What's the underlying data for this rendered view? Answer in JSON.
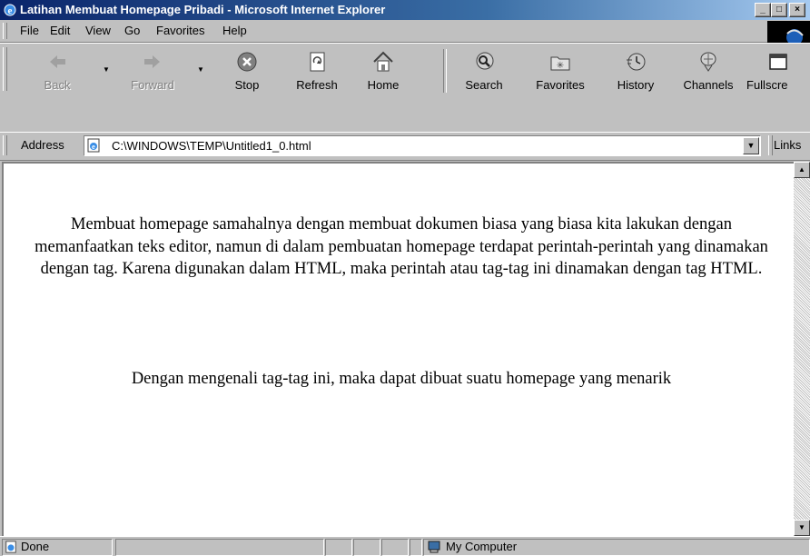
{
  "window": {
    "title": "Latihan Membuat Homepage Pribadi - Microsoft Internet Explorer",
    "controls": {
      "minimize": "_",
      "maximize": "□",
      "close": "×"
    }
  },
  "menu": {
    "items": [
      "File",
      "Edit",
      "View",
      "Go",
      "Favorites",
      "Help"
    ]
  },
  "toolbar": {
    "buttons": [
      {
        "label": "Back",
        "icon": "back-arrow-icon",
        "enabled": false
      },
      {
        "label": "Forward",
        "icon": "forward-arrow-icon",
        "enabled": false
      },
      {
        "label": "Stop",
        "icon": "stop-icon",
        "enabled": true
      },
      {
        "label": "Refresh",
        "icon": "refresh-icon",
        "enabled": true
      },
      {
        "label": "Home",
        "icon": "home-icon",
        "enabled": true
      },
      {
        "label": "Search",
        "icon": "search-icon",
        "enabled": true
      },
      {
        "label": "Favorites",
        "icon": "favorites-icon",
        "enabled": true
      },
      {
        "label": "History",
        "icon": "history-icon",
        "enabled": true
      },
      {
        "label": "Channels",
        "icon": "channels-icon",
        "enabled": true
      },
      {
        "label": "Fullscre",
        "icon": "fullscreen-icon",
        "enabled": true
      }
    ]
  },
  "address": {
    "label": "Address",
    "value": "C:\\WINDOWS\\TEMP\\Untitled1_0.html",
    "links_label": "Links"
  },
  "content": {
    "paragraph1": "Membuat homepage samahalnya dengan membuat dokumen biasa yang biasa kita lakukan dengan memanfaatkan teks editor, namun di dalam pembuatan homepage terdapat perintah-perintah yang dinamakan dengan tag. Karena digunakan dalam HTML, maka perintah atau tag-tag ini dinamakan dengan tag HTML.",
    "paragraph2": "Dengan mengenali tag-tag ini, maka dapat dibuat suatu homepage yang menarik"
  },
  "status": {
    "text": "Done",
    "zone": "My Computer"
  },
  "colors": {
    "title_start": "#0a246a",
    "title_end": "#a6caf0",
    "chrome": "#c0c0c0"
  }
}
